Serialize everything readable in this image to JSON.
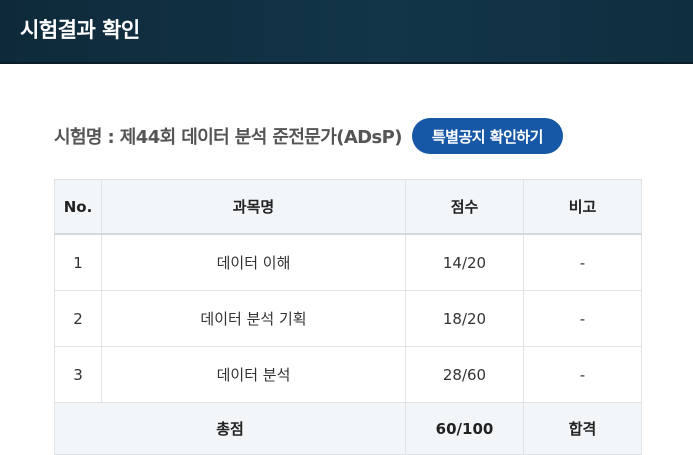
{
  "header": {
    "title": "시험결과 확인"
  },
  "exam": {
    "name": "시험명 : 제44회 데이터 분석 준전문가(ADsP)",
    "notice_button": "특별공지 확인하기"
  },
  "table": {
    "columns": [
      "No.",
      "과목명",
      "점수",
      "비고"
    ],
    "rows": [
      {
        "no": "1",
        "subject": "데이터 이해",
        "score": "14/20",
        "note": "-"
      },
      {
        "no": "2",
        "subject": "데이터 분석 기획",
        "score": "18/20",
        "note": "-"
      },
      {
        "no": "3",
        "subject": "데이터 분석",
        "score": "28/60",
        "note": "-"
      }
    ],
    "total": {
      "label": "총점",
      "score": "60/100",
      "result": "합격"
    }
  },
  "colors": {
    "header_bg": "#123548",
    "button_bg": "#1658a6",
    "table_header_bg": "#f3f6f8"
  }
}
